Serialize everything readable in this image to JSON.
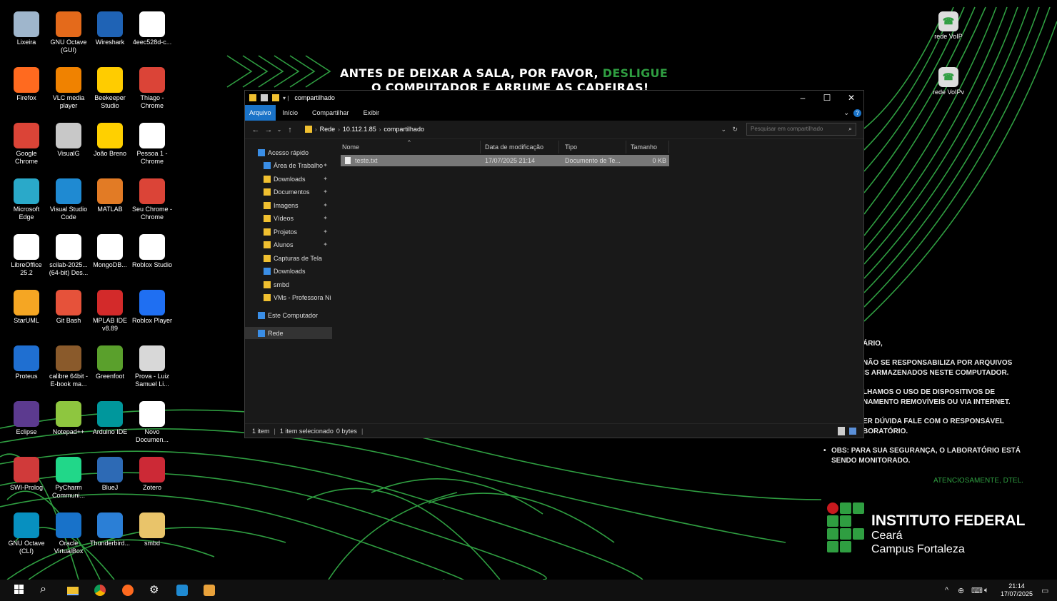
{
  "wallpaper": {
    "headline_1": "ANTES DE DEIXAR A SALA, POR FAVOR,",
    "headline_highlight": "DESLIGUE",
    "headline_2": "O COMPUTADOR E ARRUME AS CADEIRAS!",
    "notices": [
      "ÁRIO,",
      "NÃO SE RESPONSABILIZA POR ARQUIVOS",
      "IS ARMAZENADOS NESTE COMPUTADOR.",
      "LHAMOS O USO DE DISPOSITIVOS DE",
      "NAMENTO REMOVÍVEIS OU VIA INTERNET.",
      "ER DÚVIDA FALE COM O RESPONSÁVEL",
      "BORATÓRIO."
    ],
    "obs_line_1": "OBS: PARA SUA SEGURANÇA, O LABORATÓRIO ESTÁ",
    "obs_line_2": "SENDO MONITORADO.",
    "signature": "ATENCIOSAMENTE, DTEL.",
    "institute_name": "INSTITUTO FEDERAL",
    "institute_state": "Ceará",
    "institute_campus": "Campus Fortaleza",
    "accent_green": "#2f9e41"
  },
  "right_icons": [
    {
      "label": "rede VoIP",
      "icon": "voip-phone-icon"
    },
    {
      "label": "rede VoIPv",
      "icon": "voip-phone-icon"
    }
  ],
  "desktop_icons": [
    {
      "label": "Lixeira",
      "icon": "recycle-bin-icon",
      "color": "#9fb6cc"
    },
    {
      "label": "GNU Octave (GUI)",
      "icon": "octave-icon",
      "color": "#e46a1b"
    },
    {
      "label": "Wireshark",
      "icon": "wireshark-icon",
      "color": "#1f63b5"
    },
    {
      "label": "4eec528d-c...",
      "icon": "pdf-icon",
      "color": "#ffffff"
    },
    {
      "label": "Firefox",
      "icon": "firefox-icon",
      "color": "#ff6a1f"
    },
    {
      "label": "VLC media player",
      "icon": "vlc-icon",
      "color": "#f08200"
    },
    {
      "label": "Beekeeper Studio",
      "icon": "beekeeper-icon",
      "color": "#ffcc00"
    },
    {
      "label": "Thiago - Chrome",
      "icon": "chrome-profile-icon",
      "color": "#db4437"
    },
    {
      "label": "Google Chrome",
      "icon": "chrome-icon",
      "color": "#db4437"
    },
    {
      "label": "VisualG",
      "icon": "visualg-icon",
      "color": "#c8c8c8"
    },
    {
      "label": "João Breno",
      "icon": "jetbrains-icon",
      "color": "#ffd000"
    },
    {
      "label": "Pessoa 1 - Chrome",
      "icon": "document-icon",
      "color": "#ffffff"
    },
    {
      "label": "Microsoft Edge",
      "icon": "edge-icon",
      "color": "#2aa9c9"
    },
    {
      "label": "Visual Studio Code",
      "icon": "vscode-icon",
      "color": "#1f8ad2"
    },
    {
      "label": "MATLAB",
      "icon": "matlab-icon",
      "color": "#e27b25"
    },
    {
      "label": "Seu Chrome - Chrome",
      "icon": "chrome-profile-icon",
      "color": "#db4437"
    },
    {
      "label": "LibreOffice 25.2",
      "icon": "libreoffice-icon",
      "color": "#ffffff"
    },
    {
      "label": "scilab-2025... (64-bit) Des...",
      "icon": "scilab-icon",
      "color": "#ffffff"
    },
    {
      "label": "MongoDB...",
      "icon": "mongodb-icon",
      "color": "#ffffff"
    },
    {
      "label": "Roblox Studio",
      "icon": "roblox-studio-icon",
      "color": "#ffffff"
    },
    {
      "label": "StarUML",
      "icon": "staruml-icon",
      "color": "#f5a623"
    },
    {
      "label": "Git Bash",
      "icon": "git-bash-icon",
      "color": "#e6523a"
    },
    {
      "label": "MPLAB IDE v8.89",
      "icon": "mplab-icon",
      "color": "#d32a2a"
    },
    {
      "label": "Roblox Player",
      "icon": "roblox-player-icon",
      "color": "#1f6ff2"
    },
    {
      "label": "Proteus",
      "icon": "proteus-icon",
      "color": "#1f6fd1"
    },
    {
      "label": "calibre 64bit - E-book ma...",
      "icon": "calibre-icon",
      "color": "#8a5a2b"
    },
    {
      "label": "Greenfoot",
      "icon": "greenfoot-icon",
      "color": "#5aa02c"
    },
    {
      "label": "Prova - Luiz Samuel Li...",
      "icon": "c-file-icon",
      "color": "#d8d8d8"
    },
    {
      "label": "Eclipse",
      "icon": "eclipse-icon",
      "color": "#5c3a8f"
    },
    {
      "label": "Notepad++",
      "icon": "notepadpp-icon",
      "color": "#8ec63f"
    },
    {
      "label": "Arduino IDE",
      "icon": "arduino-icon",
      "color": "#00979c"
    },
    {
      "label": "Novo Documen...",
      "icon": "document-icon",
      "color": "#ffffff"
    },
    {
      "label": "SWI-Prolog",
      "icon": "prolog-icon",
      "color": "#d03a3a"
    },
    {
      "label": "PyCharm Communi...",
      "icon": "pycharm-icon",
      "color": "#21d789"
    },
    {
      "label": "BlueJ",
      "icon": "bluej-icon",
      "color": "#2d6ab5"
    },
    {
      "label": "Zotero",
      "icon": "zotero-icon",
      "color": "#cc2936"
    },
    {
      "label": "GNU Octave (CLI)",
      "icon": "octave-icon",
      "color": "#0790c0"
    },
    {
      "label": "Oracle VirtualBox",
      "icon": "virtualbox-icon",
      "color": "#1872c9"
    },
    {
      "label": "Thunderbird...",
      "icon": "thunderbird-icon",
      "color": "#2b7fd6"
    },
    {
      "label": "smbd",
      "icon": "zip-folder-icon",
      "color": "#e9c46a"
    }
  ],
  "explorer": {
    "title": "compartilhado",
    "window_buttons": {
      "minimize": "–",
      "maximize": "☐",
      "close": "✕"
    },
    "ribbon_tabs": [
      "Arquivo",
      "Início",
      "Compartilhar",
      "Exibir"
    ],
    "breadcrumb": [
      "Rede",
      "10.112.1.85",
      "compartilhado"
    ],
    "search_placeholder": "Pesquisar em compartilhado",
    "nav_items": [
      {
        "label": "Acesso rápido",
        "pinned": false,
        "icon": "star-icon"
      },
      {
        "label": "Área de Trabalho",
        "pinned": true,
        "icon": "desktop-folder-icon"
      },
      {
        "label": "Downloads",
        "pinned": true,
        "icon": "folder-icon"
      },
      {
        "label": "Documentos",
        "pinned": true,
        "icon": "folder-icon"
      },
      {
        "label": "Imagens",
        "pinned": true,
        "icon": "folder-icon"
      },
      {
        "label": "Vídeos",
        "pinned": true,
        "icon": "folder-icon"
      },
      {
        "label": "Projetos",
        "pinned": true,
        "icon": "folder-icon"
      },
      {
        "label": "Alunos",
        "pinned": true,
        "icon": "folder-icon"
      },
      {
        "label": "Capturas de Tela",
        "pinned": false,
        "icon": "folder-icon"
      },
      {
        "label": "Downloads",
        "pinned": false,
        "icon": "download-icon"
      },
      {
        "label": "smbd",
        "pinned": false,
        "icon": "folder-icon"
      },
      {
        "label": "VMs - Professora Ni",
        "pinned": false,
        "icon": "folder-icon"
      },
      {
        "label": "Este Computador",
        "pinned": false,
        "icon": "computer-icon"
      },
      {
        "label": "Rede",
        "pinned": false,
        "icon": "network-icon"
      }
    ],
    "columns": [
      "Nome",
      "Data de modificação",
      "Tipo",
      "Tamanho"
    ],
    "files": [
      {
        "name": "teste.txt",
        "modified": "17/07/2025 21:14",
        "type": "Documento de Te...",
        "size": "0 KB"
      }
    ],
    "status": {
      "count": "1 item",
      "selected": "1 item selecionado",
      "size": "0 bytes"
    }
  },
  "taskbar": {
    "time": "21:14",
    "date": "17/07/2025",
    "pinned": [
      "start-icon",
      "search-icon",
      "file-explorer-icon",
      "chrome-icon",
      "firefox-icon",
      "gear-icon",
      "vscode-icon",
      "ubuntu-icon"
    ]
  }
}
